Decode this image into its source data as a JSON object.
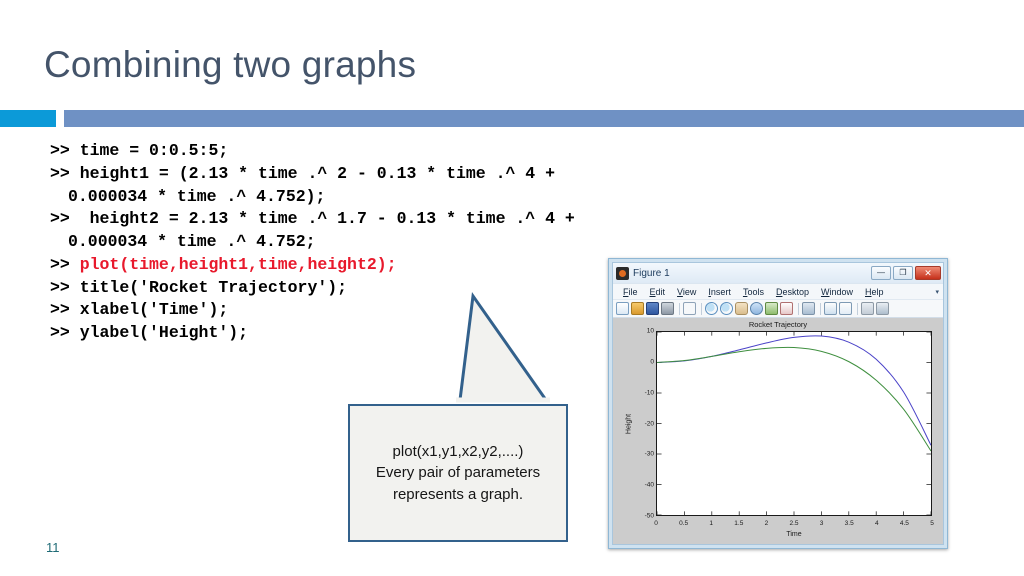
{
  "slide": {
    "title": "Combining two graphs",
    "number": "11",
    "accent_color_left": "#0c9ad8",
    "accent_color_right": "#6f91c4",
    "title_color": "#44546a"
  },
  "code": {
    "highlight_color": "#e8192c",
    "lines": [
      {
        "prompt": ">> ",
        "text": "time = 0:0.5:5;",
        "highlight": false,
        "continuation": false
      },
      {
        "prompt": ">> ",
        "text": "height1 = (2.13 * time .^ 2 - 0.13 * time .^ 4 +",
        "highlight": false,
        "continuation": false
      },
      {
        "prompt": "",
        "text": "0.000034 * time .^ 4.752);",
        "highlight": false,
        "continuation": true
      },
      {
        "prompt": ">> ",
        "text": " height2 = 2.13 * time .^ 1.7 - 0.13 * time .^ 4 +",
        "highlight": false,
        "continuation": false
      },
      {
        "prompt": "",
        "text": "0.000034 * time .^ 4.752;",
        "highlight": false,
        "continuation": true
      },
      {
        "prompt": ">> ",
        "text": "plot(time,height1,time,height2);",
        "highlight": true,
        "continuation": false
      },
      {
        "prompt": ">> ",
        "text": "title('Rocket Trajectory');",
        "highlight": false,
        "continuation": false
      },
      {
        "prompt": ">> ",
        "text": "xlabel('Time');",
        "highlight": false,
        "continuation": false
      },
      {
        "prompt": ">> ",
        "text": "ylabel('Height');",
        "highlight": false,
        "continuation": false
      }
    ]
  },
  "callout": {
    "line1": "plot(x1,y1,x2,y2,....)",
    "line2": "Every pair of parameters",
    "line3": "represents a graph.",
    "border_color": "#33618c",
    "fill_color": "#f2f2ef"
  },
  "figure_window": {
    "title": "Figure 1",
    "window_buttons": [
      {
        "name": "minimize",
        "glyph": "—"
      },
      {
        "name": "maximize",
        "glyph": "❐"
      },
      {
        "name": "close",
        "glyph": "✕"
      }
    ],
    "menu": [
      "File",
      "Edit",
      "View",
      "Insert",
      "Tools",
      "Desktop",
      "Window",
      "Help"
    ],
    "menubar_caret": "▾",
    "toolbar_icons": [
      "new-figure-icon",
      "open-file-icon",
      "save-figure-icon",
      "print-figure-icon",
      "pointer-icon",
      "zoom-in-icon",
      "zoom-out-icon",
      "pan-icon",
      "rotate-3d-icon",
      "data-cursor-icon",
      "brush-icon",
      "link-plot-icon",
      "colorbar-icon",
      "legend-icon",
      "plot-tools-off-icon",
      "plot-tools-on-icon"
    ]
  },
  "chart_data": {
    "type": "line",
    "title": "Rocket Trajectory",
    "xlabel": "Time",
    "ylabel": "Height",
    "xlim": [
      0,
      5
    ],
    "ylim": [
      -50,
      10
    ],
    "xticks": [
      0,
      0.5,
      1,
      1.5,
      2,
      2.5,
      3,
      3.5,
      4,
      4.5,
      5
    ],
    "xtick_labels": [
      "0",
      "0.5",
      "1",
      "1.5",
      "2",
      "2.5",
      "3",
      "3.5",
      "4",
      "4.5",
      "5"
    ],
    "yticks": [
      10,
      0,
      -10,
      -20,
      -30,
      -40,
      -50
    ],
    "ytick_labels": [
      "10",
      "0",
      "-10",
      "-20",
      "-30",
      "-40",
      "-50"
    ],
    "grid": false,
    "legend": null,
    "x": [
      0,
      0.5,
      1,
      1.5,
      2,
      2.5,
      3,
      3.5,
      4,
      4.5,
      5
    ],
    "series": [
      {
        "name": "height1",
        "color": "#4a42c8",
        "values": [
          0,
          0.52,
          2.0,
          4.14,
          6.44,
          8.23,
          8.67,
          6.66,
          1.05,
          -9.68,
          -27.14
        ]
      },
      {
        "name": "height2",
        "color": "#3f8f3f",
        "values": [
          0,
          0.65,
          2.0,
          3.52,
          4.65,
          4.92,
          3.66,
          0.29,
          -5.82,
          -15.31,
          -29.01
        ]
      }
    ]
  }
}
